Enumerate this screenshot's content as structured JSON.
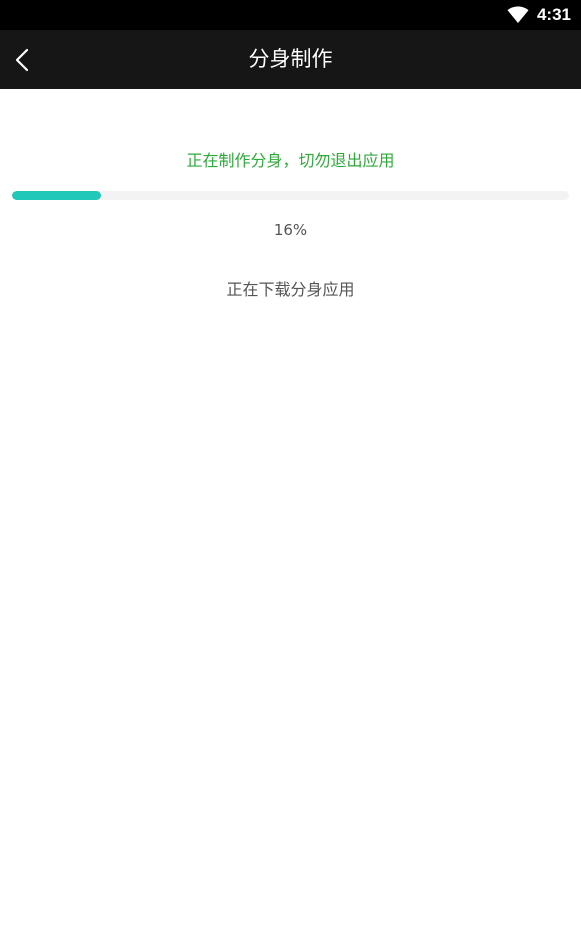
{
  "status_bar": {
    "time": "4:31",
    "icons": [
      "wifi-icon"
    ]
  },
  "app_bar": {
    "title": "分身制作",
    "back_icon": "chevron-left-icon"
  },
  "main": {
    "warning": "正在制作分身，切勿退出应用",
    "progress": {
      "percent": 16,
      "label": "16%"
    },
    "status": "正在下载分身应用"
  },
  "colors": {
    "warning_text": "#2eaa3a",
    "progress_fill": "#1fc8b8",
    "progress_track": "#f3f3f3",
    "app_bar_bg": "#161616",
    "status_bar_bg": "#000000"
  }
}
